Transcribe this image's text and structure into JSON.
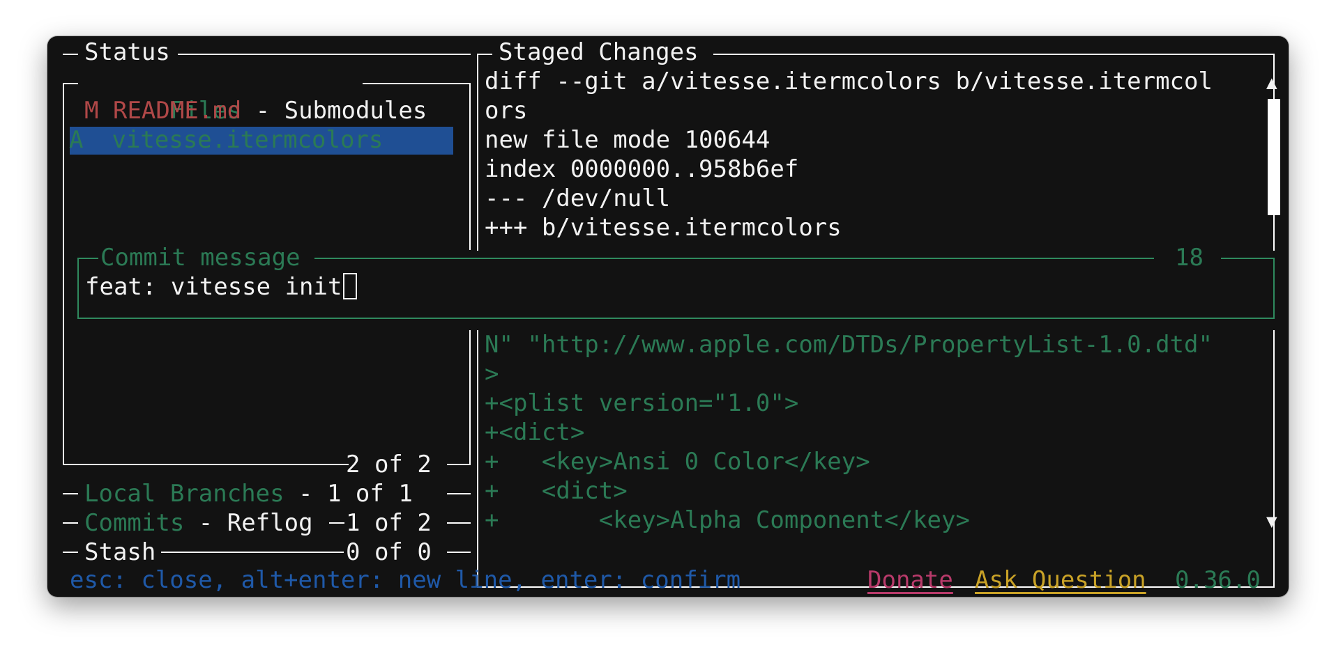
{
  "status_panel": {
    "title": "Status"
  },
  "files_panel": {
    "tab_active": "Files",
    "tab_separator": " - ",
    "tab_other": "Submodules",
    "files": [
      {
        "status": "M",
        "name": "README.md",
        "color": "#b04848"
      },
      {
        "status": "A",
        "name": "vitesse.itermcolors",
        "color": "#2b7a55",
        "selected": true
      }
    ],
    "counter": "2 of 2"
  },
  "local_branches": {
    "label": "Local Branches",
    "suffix": " - 1 of 1"
  },
  "commits": {
    "label": "Commits",
    "separator": " - ",
    "reflog": "Reflog",
    "counter": "1 of 2"
  },
  "stash": {
    "label": "Stash",
    "counter": "0 of 0"
  },
  "staged_changes": {
    "title": "Staged Changes",
    "top_lines": [
      "diff --git a/vitesse.itermcolors b/vitesse.itermcol",
      "ors",
      "new file mode 100644",
      "index 0000000..958b6ef",
      "--- /dev/null",
      "+++ b/vitesse.itermcolors"
    ],
    "bottom_lines": [
      "N\" \"http://www.apple.com/DTDs/PropertyList-1.0.dtd\"",
      ">",
      "+<plist version=\"1.0\">",
      "+<dict>",
      "+   <key>Ansi 0 Color</key>",
      "+   <dict>",
      "+       <key>Alpha Component</key>"
    ],
    "scroll_up_icon": "▲",
    "scroll_down_icon": "▼"
  },
  "commit_message": {
    "title": "Commit message",
    "char_count": "18",
    "value": "feat: vitesse init"
  },
  "footer": {
    "hints": "esc: close, alt+enter: new line, enter: confirm",
    "donate": "Donate",
    "ask_question": "Ask Question",
    "version": "0.36.0"
  },
  "colors": {
    "background": "#121212",
    "accent_green": "#2b7a55",
    "modified_red": "#b04848",
    "hint_blue": "#1f59a8",
    "selection_blue": "#1f4f94",
    "donate_pink": "#b83a6a",
    "ask_yellow": "#c9a227"
  }
}
